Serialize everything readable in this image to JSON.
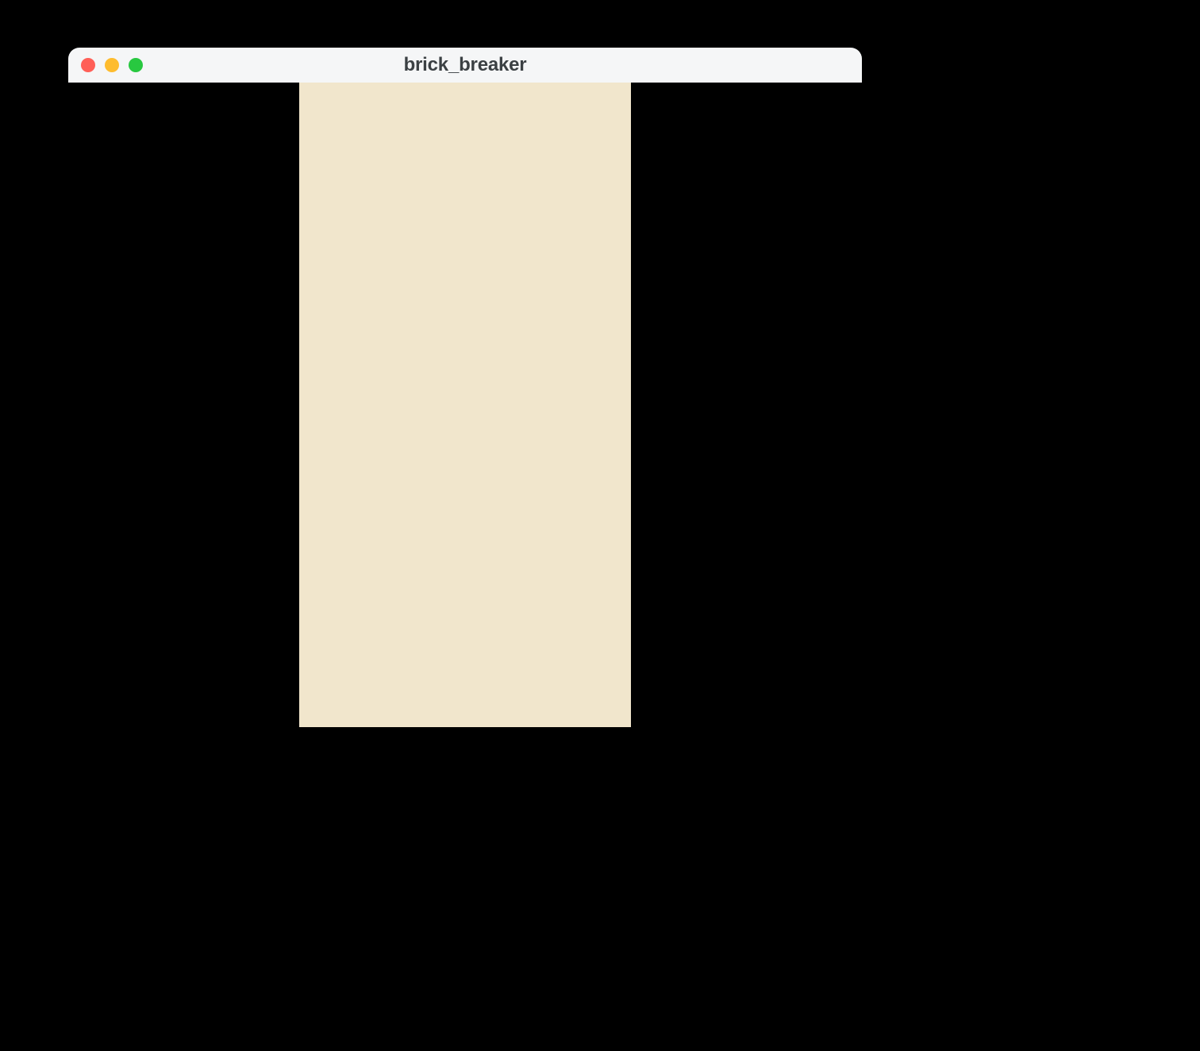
{
  "window": {
    "title": "brick_breaker"
  },
  "colors": {
    "page_bg": "#000000",
    "titlebar_bg": "#f5f6f7",
    "title_text": "#3b4043",
    "canvas_bg": "#f1e6cc",
    "traffic_close": "#ff5f57",
    "traffic_min": "#febc2e",
    "traffic_max": "#28c840"
  }
}
